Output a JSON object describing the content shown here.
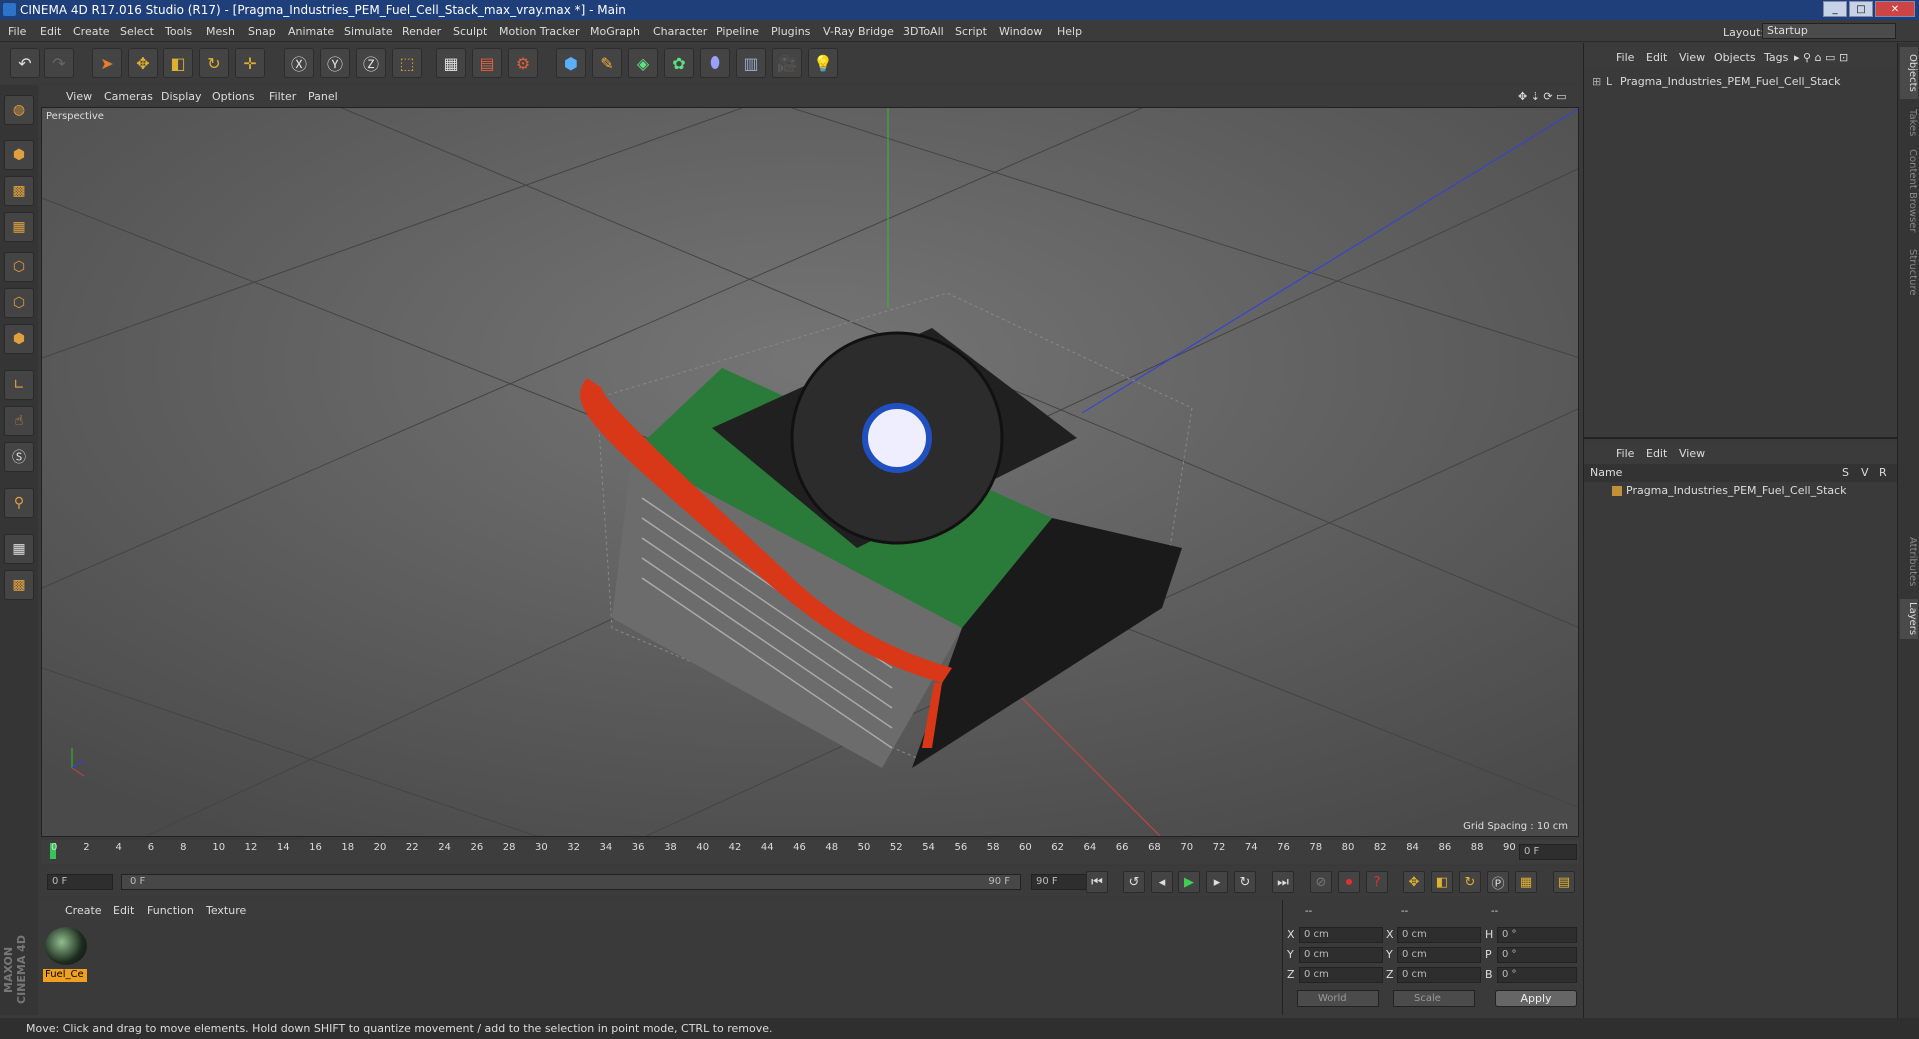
{
  "window": {
    "title": "CINEMA 4D R17.016 Studio (R17) - [Pragma_Industries_PEM_Fuel_Cell_Stack_max_vray.max *] - Main"
  },
  "menubar": [
    "File",
    "Edit",
    "Create",
    "Select",
    "Tools",
    "Mesh",
    "Snap",
    "Animate",
    "Simulate",
    "Render",
    "Sculpt",
    "Motion Tracker",
    "MoGraph",
    "Character",
    "Pipeline",
    "Plugins",
    "V-Ray Bridge",
    "3DToAll",
    "Script",
    "Window",
    "Help"
  ],
  "layout": {
    "label": "Layout:",
    "value": "Startup"
  },
  "viewport": {
    "menu": [
      "View",
      "Cameras",
      "Display",
      "Options",
      "Filter",
      "Panel"
    ],
    "label": "Perspective",
    "grid_spacing": "Grid Spacing : 10 cm"
  },
  "timeline": {
    "ticks": [
      "0",
      "2",
      "4",
      "6",
      "8",
      "10",
      "12",
      "14",
      "16",
      "18",
      "20",
      "22",
      "24",
      "26",
      "28",
      "30",
      "32",
      "34",
      "36",
      "38",
      "40",
      "42",
      "44",
      "46",
      "48",
      "50",
      "52",
      "54",
      "56",
      "58",
      "60",
      "62",
      "64",
      "66",
      "68",
      "70",
      "72",
      "74",
      "76",
      "78",
      "80",
      "82",
      "84",
      "86",
      "88",
      "90"
    ],
    "current_frame": "0 F",
    "start_field": "0 F",
    "range_start": "0 F",
    "range_end": "90 F",
    "end_field": "90 F"
  },
  "material_panel": {
    "menu": [
      "Create",
      "Edit",
      "Function",
      "Texture"
    ],
    "material_label": "Fuel_Ce"
  },
  "coordinates": {
    "headers": [
      "--",
      "--",
      "--"
    ],
    "rows": [
      {
        "axis": "X",
        "pos": "0 cm",
        "axis2": "X",
        "size": "0 cm",
        "rot_axis": "H",
        "rot": "0 °"
      },
      {
        "axis": "Y",
        "pos": "0 cm",
        "axis2": "Y",
        "size": "0 cm",
        "rot_axis": "P",
        "rot": "0 °"
      },
      {
        "axis": "Z",
        "pos": "0 cm",
        "axis2": "Z",
        "size": "0 cm",
        "rot_axis": "B",
        "rot": "0 °"
      }
    ],
    "space_dropdown": "World",
    "mode_dropdown": "Scale",
    "apply_label": "Apply"
  },
  "objects_panel": {
    "menu": [
      "File",
      "Edit",
      "View",
      "Objects",
      "Tags"
    ],
    "object_name": "Pragma_Industries_PEM_Fuel_Cell_Stack"
  },
  "layers_panel": {
    "menu": [
      "File",
      "Edit",
      "View"
    ],
    "header_name": "Name",
    "header_cols": [
      "S",
      "V",
      "R"
    ],
    "layer_name": "Pragma_Industries_PEM_Fuel_Cell_Stack"
  },
  "side_tabs": [
    "Objects",
    "Takes",
    "Content Browser",
    "Structure",
    "Attributes",
    "Layers"
  ],
  "brand": "MAXON CINEMA 4D",
  "status": "Move: Click and drag to move elements. Hold down SHIFT to quantize movement / add to the selection in point mode, CTRL to remove.",
  "colors": {
    "title_bar": "#1f3f7a",
    "accent": "#f0a020",
    "timeline_marker": "#35c35a"
  }
}
